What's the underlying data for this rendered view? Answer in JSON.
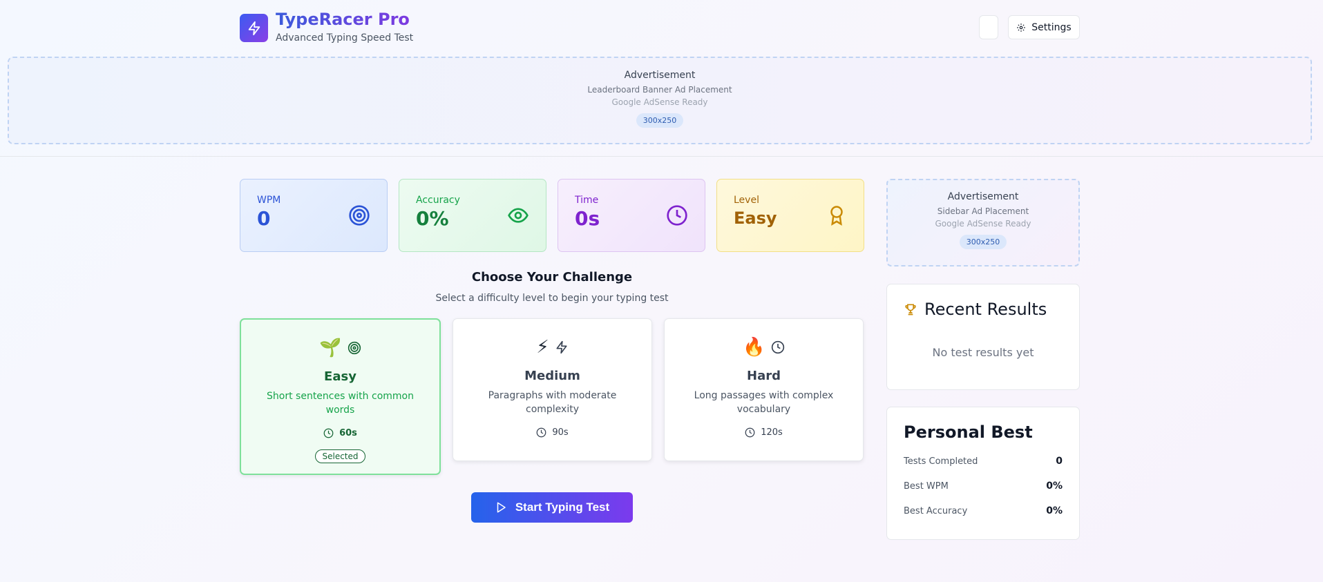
{
  "header": {
    "title": "TypeRacer Pro",
    "subtitle": "Advanced Typing Speed Test",
    "settings_label": "Settings"
  },
  "banner_ad": {
    "title": "Advertisement",
    "line1": "Leaderboard Banner Ad Placement",
    "line2": "Google AdSense Ready",
    "size": "300x250"
  },
  "stats": {
    "wpm": {
      "label": "WPM",
      "value": "0"
    },
    "accuracy": {
      "label": "Accuracy",
      "value": "0%"
    },
    "time": {
      "label": "Time",
      "value": "0s"
    },
    "level": {
      "label": "Level",
      "value": "Easy"
    }
  },
  "challenge": {
    "title": "Choose Your Challenge",
    "subtitle": "Select a difficulty level to begin your typing test",
    "levels": [
      {
        "emoji": "🌱",
        "name": "Easy",
        "desc": "Short sentences with common words",
        "duration": "60s",
        "selected_label": "Selected"
      },
      {
        "emoji": "⚡",
        "name": "Medium",
        "desc": "Paragraphs with moderate complexity",
        "duration": "90s"
      },
      {
        "emoji": "🔥",
        "name": "Hard",
        "desc": "Long passages with complex vocabulary",
        "duration": "120s"
      }
    ]
  },
  "start_button": "Start Typing Test",
  "side_ad": {
    "title": "Advertisement",
    "line1": "Sidebar Ad Placement",
    "line2": "Google AdSense Ready",
    "size": "300x250"
  },
  "recent": {
    "title": "Recent Results",
    "empty": "No test results yet"
  },
  "personal_best": {
    "title": "Personal Best",
    "rows": [
      {
        "label": "Tests Completed",
        "value": "0"
      },
      {
        "label": "Best WPM",
        "value": "0%"
      },
      {
        "label": "Best Accuracy",
        "value": "0%"
      }
    ]
  },
  "colors": {
    "wpm": "#2b53d6",
    "accuracy": "#16a34a",
    "time": "#7e22ce",
    "level": "#b45309"
  }
}
